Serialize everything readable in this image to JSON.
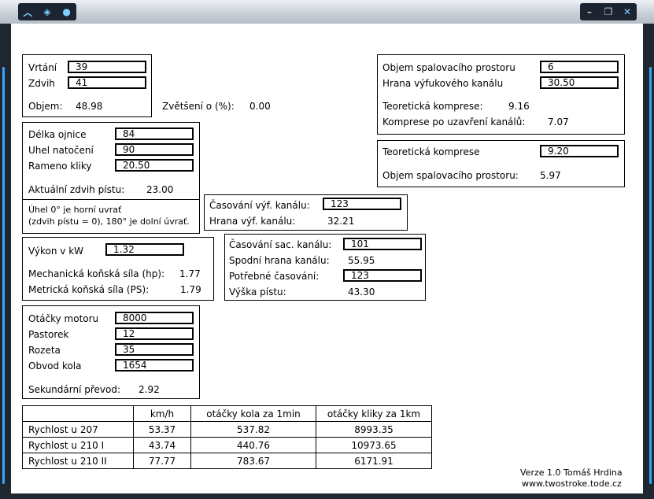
{
  "title_bar": {
    "icons": [
      "chevron-up-icon",
      "alien-icon",
      "alien-head-icon"
    ],
    "controls": [
      "minimize-icon",
      "restore-icon",
      "close-icon"
    ]
  },
  "bore_stroke": {
    "vrtani_label": "Vrtání",
    "vrtani_value": "39",
    "zdvih_label": "Zdvih",
    "zdvih_value": "41",
    "objem_label": "Objem:",
    "objem_value": "48.98"
  },
  "zvetseni": {
    "label": "Zvětšení o (%):",
    "value": "0.00"
  },
  "rod": {
    "ojnice_label": "Délka ojnice",
    "ojnice_value": "84",
    "uhel_label": "Uhel natočení",
    "uhel_value": "90",
    "rameno_label": "Rameno kliky",
    "rameno_value": "20.50",
    "aktualni_label": "Aktuální zdvih pístu:",
    "aktualni_value": "23.00"
  },
  "note": {
    "line1": "Úhel 0° je horní uvrať",
    "line2": "(zdvih pístu = 0), 180° je dolní úvrať."
  },
  "compression": {
    "objem_label": "Objem spalovacího prostoru",
    "objem_value": "6",
    "hrana_label": "Hrana výfukového kanálu",
    "hrana_value": "30.50",
    "teoreticka_label": "Teoretická komprese:",
    "teoreticka_value": "9.16",
    "po_uzavreni_label": "Komprese po uzavření kanálů:",
    "po_uzavreni_value": "7.07"
  },
  "compression2": {
    "teoreticka_label": "Teoretická komprese",
    "teoreticka_value": "9.20",
    "objem_label": "Objem spalovacího prostoru:",
    "objem_value": "5.97"
  },
  "exhaust": {
    "casovani_label": "Časování výf. kanálu:",
    "casovani_value": "123",
    "hrana_label": "Hrana výf. kanálu:",
    "hrana_value": "32.21"
  },
  "power": {
    "vykon_label": "Výkon v kW",
    "vykon_value": "1.32",
    "hp_label": "Mechanická koňská síla (hp):",
    "hp_value": "1.77",
    "ps_label": "Metrická koňská síla (PS):",
    "ps_value": "1.79"
  },
  "transfer": {
    "casovani_label": "Časování sac. kanálu:",
    "casovani_value": "101",
    "spodni_label": "Spodní hrana kanálu:",
    "spodni_value": "55.95",
    "potrebne_label": "Potřebné časování:",
    "potrebne_value": "123",
    "vyska_label": "Výška pístu:",
    "vyska_value": "43.30"
  },
  "gearing": {
    "otacky_label": "Otáčky motoru",
    "otacky_value": "8000",
    "pastorek_label": "Pastorek",
    "pastorek_value": "12",
    "rozeta_label": "Rozeta",
    "rozeta_value": "35",
    "obvod_label": "Obvod kola",
    "obvod_value": "1654",
    "sekundarni_label": "Sekundární převod:",
    "sekundarni_value": "2.92"
  },
  "speed_table": {
    "headers": [
      "",
      "km/h",
      "otáčky kola za 1min",
      "otáčky kliky za 1km"
    ],
    "rows": [
      [
        "Rychlost u 207",
        "53.37",
        "537.82",
        "8993.35"
      ],
      [
        "Rychlost u 210 I",
        "43.74",
        "440.76",
        "10973.65"
      ],
      [
        "Rychlost u 210 II",
        "77.77",
        "783.67",
        "6171.91"
      ]
    ]
  },
  "footer": {
    "version": "Verze 1.0 Tomáš Hrdina",
    "url": "www.twostroke.tode.cz"
  }
}
